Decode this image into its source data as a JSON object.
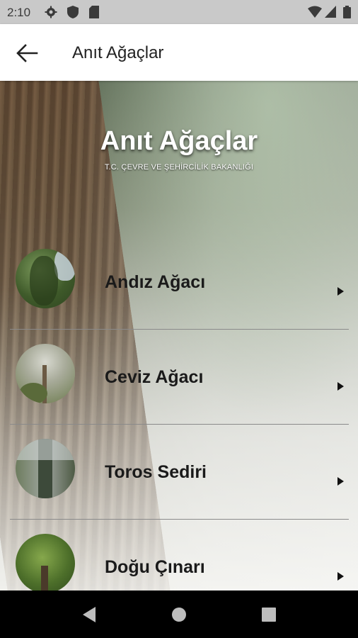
{
  "status_bar": {
    "time": "2:10",
    "icons": [
      "gear-icon",
      "shield-icon",
      "sd-card-icon",
      "wifi-icon",
      "signal-icon",
      "battery-icon"
    ]
  },
  "app_bar": {
    "title": "Anıt Ağaçlar",
    "back_icon": "arrow-left-icon"
  },
  "hero": {
    "title": "Anıt Ağaçlar",
    "subtitle": "T.C. ÇEVRE VE ŞEHİRCİLİK BAKANLIĞI"
  },
  "trees": [
    {
      "name": "Andız Ağacı",
      "colors": [
        "#3f5a2a",
        "#7c9a5c",
        "#cfd9e6"
      ]
    },
    {
      "name": "Ceviz Ağacı",
      "colors": [
        "#6b7a4c",
        "#c8c9bf",
        "#5a6a3a"
      ]
    },
    {
      "name": "Toros Sediri",
      "colors": [
        "#3d4a3a",
        "#a0a6a0",
        "#6d7c5e"
      ]
    },
    {
      "name": "Doğu Çınarı",
      "colors": [
        "#4d6f2a",
        "#86a84c",
        "#2f4a1c"
      ]
    }
  ],
  "nav_bar": {
    "icons": [
      "back-triangle-icon",
      "home-circle-icon",
      "recents-square-icon"
    ]
  }
}
